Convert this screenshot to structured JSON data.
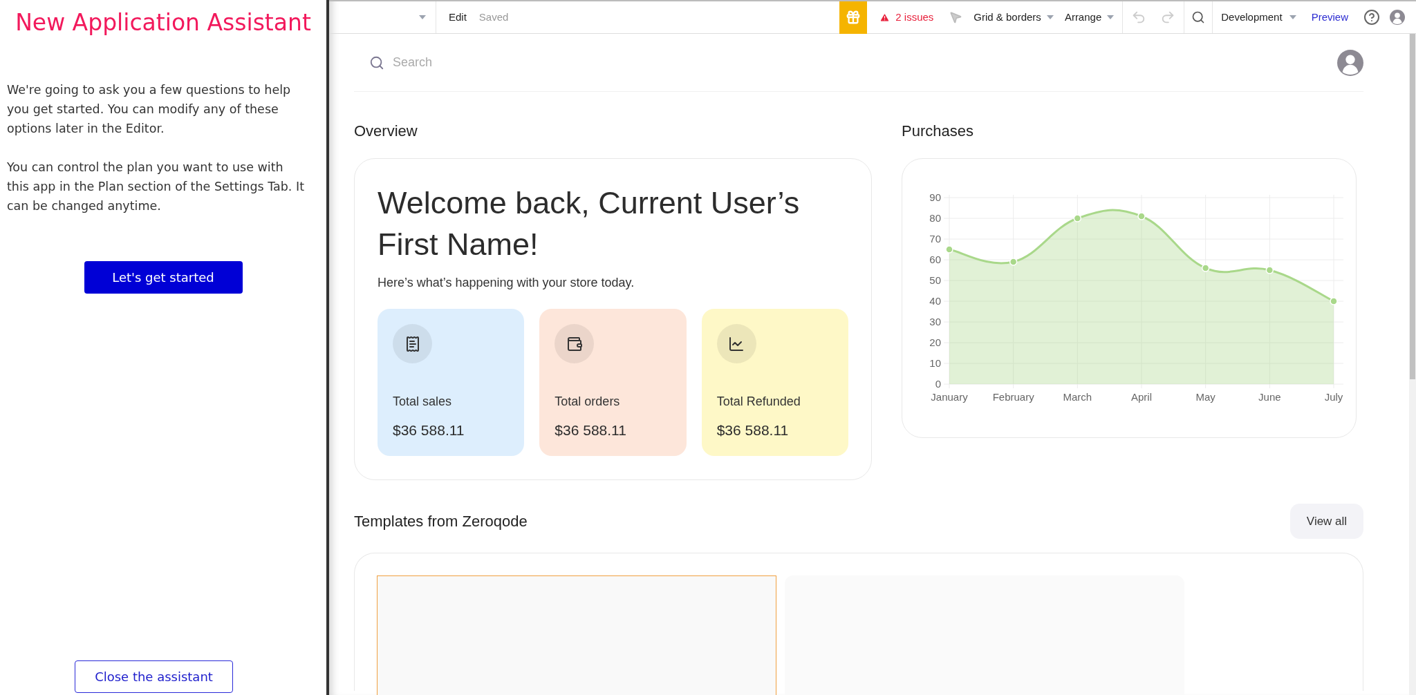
{
  "assistant": {
    "title": "New Application Assistant",
    "paragraphs": [
      "We're going to ask you a few questions to help you get started. You can modify any of these options later in the Editor.",
      "You can control the plan you want to use with this app in the Plan section of the Settings Tab. It can be changed anytime."
    ],
    "start_button": "Let's get started",
    "close_button": "Close the assistant"
  },
  "toolbar": {
    "edit": "Edit",
    "status": "Saved",
    "issues": "2 issues",
    "grid": "Grid & borders",
    "arrange": "Arrange",
    "mode": "Development",
    "preview": "Preview"
  },
  "search": {
    "placeholder": "Search"
  },
  "overview": {
    "title": "Overview",
    "welcome": "Welcome back, Current User’s First Name!",
    "subtitle": "Here’s what’s happening with your store today.",
    "stats": [
      {
        "kind": "receipt",
        "label": "Total sales",
        "value": "$36 588.11",
        "color": "#ddeefd"
      },
      {
        "kind": "wallet",
        "label": "Total orders",
        "value": "$36 588.11",
        "color": "#fde6da"
      },
      {
        "kind": "chart",
        "label": "Total Refunded",
        "value": "$36 588.11",
        "color": "#fef8c7"
      }
    ]
  },
  "purchases": {
    "title": "Purchases",
    "chart_data": {
      "type": "area",
      "categories": [
        "January",
        "February",
        "March",
        "April",
        "May",
        "June",
        "July"
      ],
      "series": [
        {
          "color": "#a9d88a",
          "values": [
            65,
            59,
            80,
            81,
            56,
            55,
            40
          ]
        }
      ],
      "grid": true,
      "ylim": [
        0,
        90
      ],
      "yticks": [
        0,
        10,
        20,
        30,
        40,
        50,
        60,
        70,
        80,
        90
      ]
    }
  },
  "templates": {
    "title": "Templates from Zeroqode",
    "view_all": "View all",
    "items": [
      {
        "selected": true
      },
      {
        "selected": false
      }
    ]
  }
}
